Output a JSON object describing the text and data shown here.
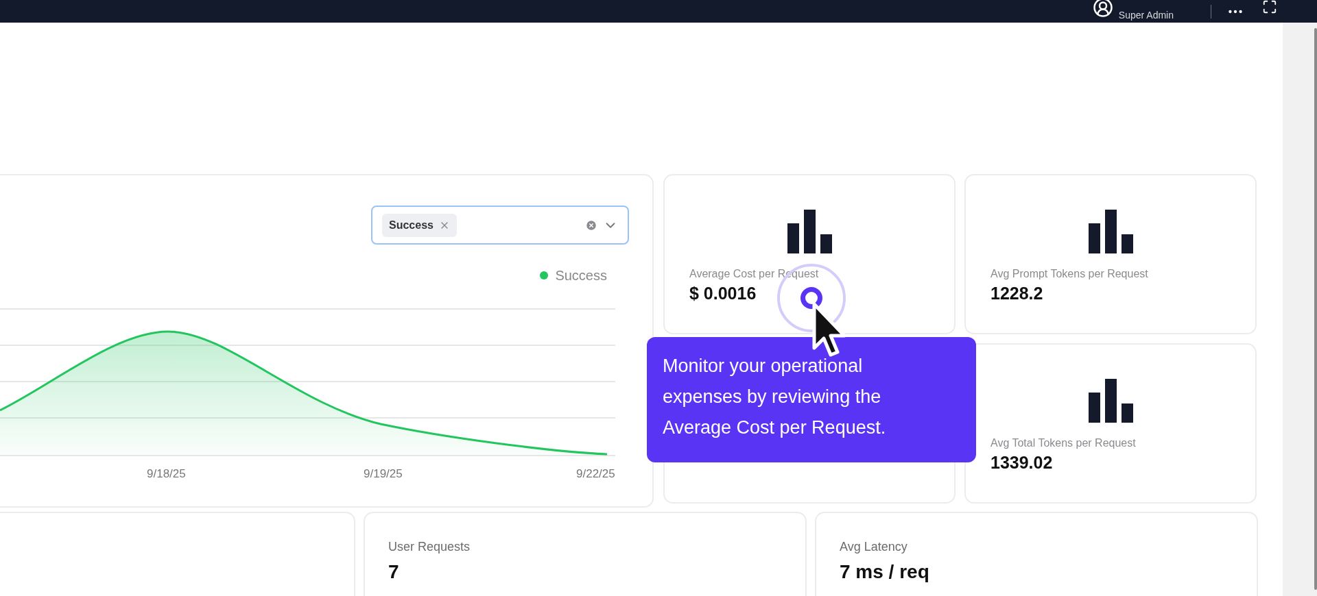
{
  "top_bar": {
    "user_role": "Super Admin"
  },
  "status_filter": {
    "tags": [
      {
        "label": "Success"
      }
    ]
  },
  "chart": {
    "legend": [
      {
        "label": "Success",
        "color": "#22c55e"
      }
    ],
    "x_labels": [
      "9/18/25",
      "9/19/25",
      "9/22/25"
    ]
  },
  "stat_rows": [
    [
      {
        "kind": "stat",
        "label": "Average Cost per Request",
        "value": "$ 0.0016"
      },
      {
        "kind": "stat",
        "label": "Avg Prompt Tokens per Request",
        "value": "1228.2"
      }
    ],
    [
      {
        "kind": "covered"
      },
      {
        "kind": "stat",
        "label": "Avg Total Tokens per Request",
        "value": "1339.02"
      }
    ]
  ],
  "bottom_cards": [
    {
      "kind": "empty"
    },
    {
      "kind": "stat",
      "label": "User Requests",
      "value": "7"
    },
    {
      "kind": "stat",
      "label": "Avg Latency",
      "value": "7 ms / req"
    }
  ],
  "tooltip": {
    "text": "Monitor your operational expenses by reviewing the Average Cost per Request."
  }
}
